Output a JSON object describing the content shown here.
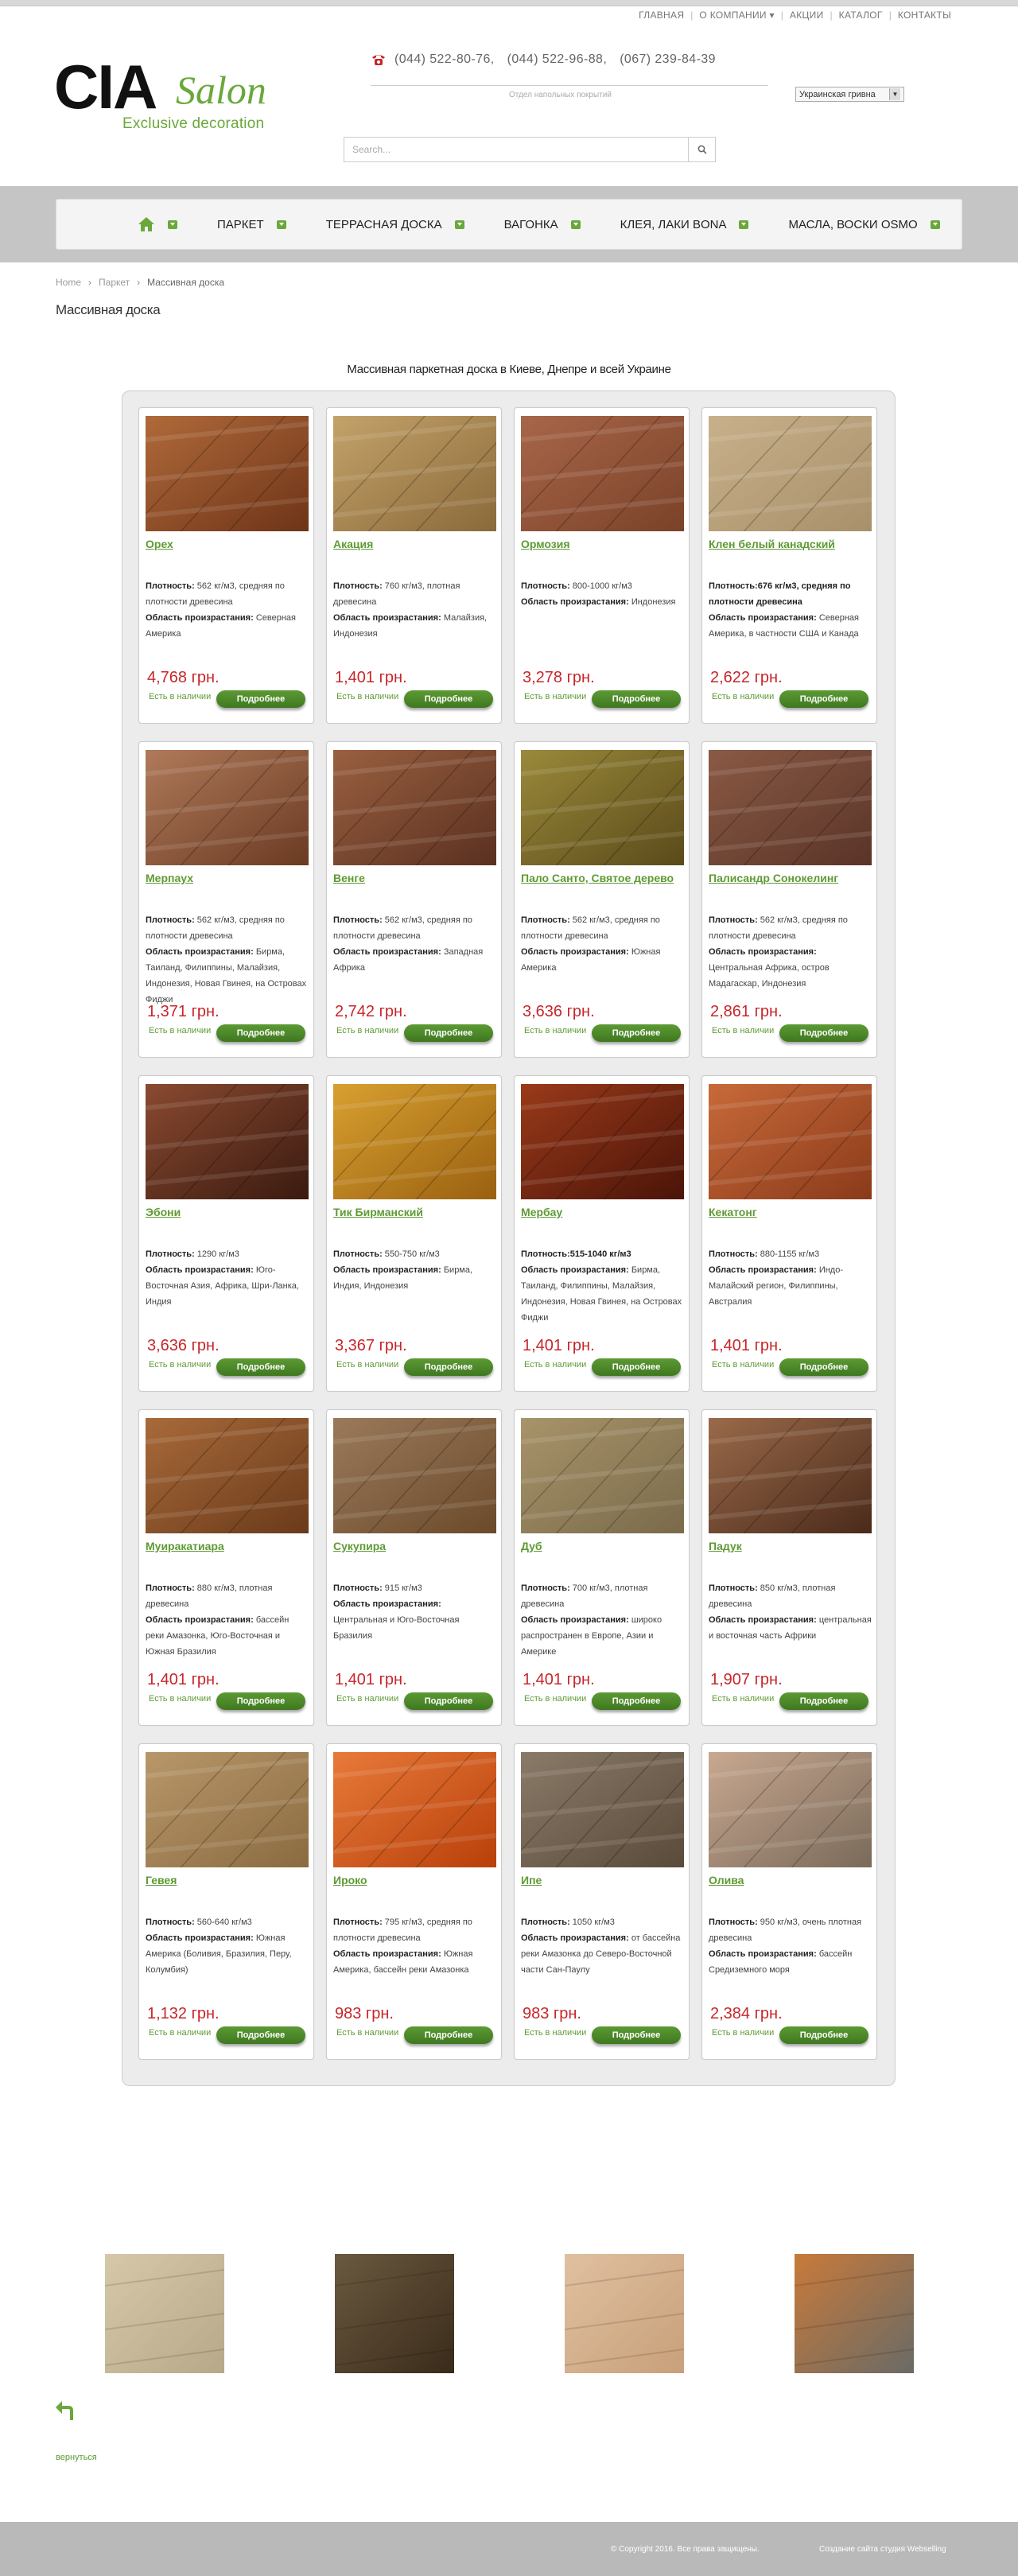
{
  "topnav": [
    {
      "label": "ГЛАВНАЯ"
    },
    {
      "label": "О КОМПАНИИ ▾"
    },
    {
      "label": "АКЦИИ"
    },
    {
      "label": "КАТАЛОГ"
    },
    {
      "label": "КОНТАКТЫ"
    }
  ],
  "logo": {
    "main": "CIA",
    "script": "Salon",
    "tagline": "Exclusive decoration"
  },
  "phones": [
    "(044) 522-80-76,",
    "(044) 522-96-88,",
    "(067) 239-84-39"
  ],
  "dept": "Отдел напольных покрытий",
  "currency": "Украинская гривна",
  "search": {
    "placeholder": "Search..."
  },
  "nav": [
    {
      "label": ""
    },
    {
      "label": "ПАРКЕТ"
    },
    {
      "label": "ТЕРРАСНАЯ ДОСКА"
    },
    {
      "label": "ВАГОНКА"
    },
    {
      "label": "КЛЕЯ, ЛАКИ BONA"
    },
    {
      "label": "МАСЛА, ВОСКИ OSMO"
    }
  ],
  "breadcrumb": [
    "Home",
    "Паркет",
    "Массивная доска"
  ],
  "page_title": "Массивная доска",
  "subtitle": "Массивная паркетная доска в Киеве, Днепре и всей Украине",
  "labels": {
    "density": "Плотность:",
    "area": "Область произрастания:",
    "stock": "Есть в наличии",
    "more": "Подробнее"
  },
  "products": [
    {
      "name": "Орех",
      "density": " 562 кг/м3, средняя по плотности древесина",
      "area": "Северная Америка",
      "price": "4,768 грн.",
      "colors": [
        "#6e3418",
        "#b06a3a"
      ]
    },
    {
      "name": "Акация",
      "density": " 760 кг/м3, плотная древесина",
      "area": "Малайзия, Индонезия",
      "price": "1,401 грн.",
      "colors": [
        "#8a6a3a",
        "#c4a26a"
      ]
    },
    {
      "name": "Ормозия",
      "density": " 800-1000 кг/м3",
      "area": "Индонезия",
      "price": "3,278 грн.",
      "colors": [
        "#7a4228",
        "#a8664a"
      ]
    },
    {
      "name": "Клен белый канадский",
      "density": "676 кг/м3, средняя по плотности древесина",
      "density_bold": true,
      "area": "Северная Америка, в частности США и Канада",
      "price": "2,622 грн.",
      "colors": [
        "#a8906a",
        "#c8b08a"
      ]
    },
    {
      "name": "Мерпаух",
      "density": " 562 кг/м3, средняя по плотности древесина",
      "area": "Бирма, Таиланд, Филиппины, Малайзия, Индонезия, Новая Гвинея, на Островах Фиджи",
      "price": "1,371 грн.",
      "colors": [
        "#6a3a22",
        "#b07a5a"
      ]
    },
    {
      "name": "Венге",
      "density": " 562 кг/м3, средняя по плотности древесина",
      "area": "Западная Африка",
      "price": "2,742 грн.",
      "colors": [
        "#5a3020",
        "#9a6040"
      ]
    },
    {
      "name": "Пало Санто, Святое дерево",
      "density": " 562 кг/м3, средняя по плотности древесина",
      "area": "Южная Америка",
      "price": "3,636 грн.",
      "colors": [
        "#5a4a1a",
        "#9a8a3a"
      ]
    },
    {
      "name": "Палисандр Сонокелинг",
      "density": " 562 кг/м3, средняя по плотности древесина",
      "area": "Центральная Африка, остров Мадагаскар, Индонезия",
      "price": "2,861 грн.",
      "colors": [
        "#5a3428",
        "#8a5a44"
      ]
    },
    {
      "name": "Эбони",
      "density": " 1290 кг/м3",
      "area": "Юго-Восточная Азия, Африка, Шри-Ланка, Индия",
      "price": "3,636 грн.",
      "colors": [
        "#3a1a10",
        "#8a4a30"
      ]
    },
    {
      "name": "Тик Бирманский",
      "density": " 550-750 кг/м3",
      "area": "Бирма, Индия, Индонезия",
      "price": "3,367 грн.",
      "colors": [
        "#9a6010",
        "#d8a030"
      ]
    },
    {
      "name": "Мербау",
      "density": "515-1040 кг/м3",
      "density_bold": true,
      "area": "Бирма, Таиланд, Филиппины, Малайзия, Индонезия, Новая Гвинея, на Островах Фиджи",
      "price": "1,401 грн.",
      "colors": [
        "#4a1408",
        "#9a3a1a"
      ]
    },
    {
      "name": "Кекатонг",
      "density": " 880-1155 кг/м3",
      "area": "Индо-Малайский регион, Филиппины, Австралия",
      "price": "1,401 грн.",
      "colors": [
        "#8a3a1a",
        "#c86a3a"
      ]
    },
    {
      "name": "Муиракатиара",
      "density": " 880 кг/м3, плотная древесина",
      "area": "бассейн реки Амазонка, Юго-Восточная и Южная Бразилия",
      "price": "1,401 грн.",
      "colors": [
        "#6a3a1a",
        "#a86a3a"
      ]
    },
    {
      "name": "Сукупира",
      "density": " 915 кг/м3",
      "area": "Центральная и Юго-Восточная Бразилия",
      "price": "1,401 грн.",
      "colors": [
        "#6a4a2a",
        "#9a7a5a"
      ]
    },
    {
      "name": "Дуб",
      "density": " 700 кг/м3, плотная древесина",
      "area": " широко распространен в Европе, Азии и Америке",
      "price": "1,401 грн.",
      "colors": [
        "#7a6a4a",
        "#a8946a"
      ]
    },
    {
      "name": "Падук",
      "density": " 850 кг/м3, плотная древесина",
      "area": "центральная и восточная часть Африки",
      "price": "1,907 грн.",
      "colors": [
        "#4a2a1a",
        "#9a6a4a"
      ]
    },
    {
      "name": "Гевея",
      "density": " 560-640 кг/м3",
      "area": "Южная Америка (Боливия, Бразилия, Перу, Колумбия)",
      "price": "1,132 грн.",
      "colors": [
        "#8a6a40",
        "#b8986a"
      ]
    },
    {
      "name": "Ироко",
      "density": " 795 кг/м3, средняя по плотности древесина",
      "area": "Южная Америка, бассейн реки Амазонка",
      "price": "983 грн.",
      "colors": [
        "#b8400a",
        "#e87a3a"
      ]
    },
    {
      "name": "Ипе",
      "density": " 1050 кг/м3",
      "area": "от бассейна реки Амазонка до Северо-Восточной части Сан-Паулу",
      "price": "983 грн.",
      "colors": [
        "#5a4a3a",
        "#8a7a68"
      ]
    },
    {
      "name": "Олива",
      "density": " 950 кг/м3, очень плотная древесина",
      "area": "бассейн Средиземного моря",
      "price": "2,384 грн.",
      "colors": [
        "#7a6a5a",
        "#c8a890"
      ]
    }
  ],
  "thumbs": [
    {
      "colors": [
        "#b8a88a",
        "#d8c8aa"
      ]
    },
    {
      "colors": [
        "#3a2a1a",
        "#6a5a40"
      ]
    },
    {
      "colors": [
        "#c8a07a",
        "#e0c0a0"
      ]
    },
    {
      "colors": [
        "#6a6a66",
        "#c87a3a"
      ]
    }
  ],
  "back_label": "вернуться",
  "footer": {
    "copyright": "© Copyright 2016. Все права защищены.",
    "developer": "Создание сайта студия Webselling"
  },
  "accent": "#6aa83a",
  "price_color": "#c8262a"
}
